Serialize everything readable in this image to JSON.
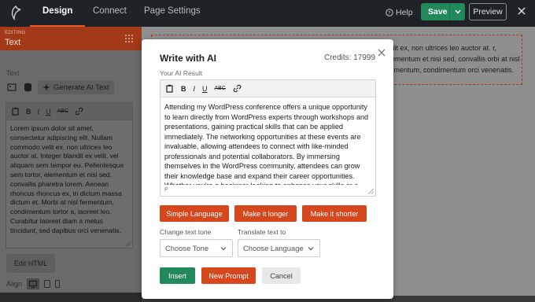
{
  "topbar": {
    "tabs": [
      {
        "label": "Design",
        "active": true
      },
      {
        "label": "Connect",
        "active": false
      },
      {
        "label": "Page Settings",
        "active": false
      }
    ],
    "help_label": "Help",
    "save_label": "Save",
    "preview_label": "Preview",
    "accent_color": "#e8562a"
  },
  "sidebar": {
    "kicker": "EDITING",
    "title": "Text",
    "field_label": "Text",
    "generate_label": "Generate AI Text",
    "editor_text": "Lorem ipsum dolor sit amet, consectetur adipiscing elit. Nullam commodo velit ex, non ultrices leo auctor at. Integer blandit ex velit, vel aliquam sem tempor eu. Pellentesque sem tortor, elementum et nisi sed, convallis pharetra lorem. Aenean rhoncus rhoncus ex, in dictum massa dictum et. Morbi at nisl fermentum, condimentum tortor a, laoreet leo. Curabitur laoreet diam a metus tincidunt, sed dapibus orci venenatis.",
    "edit_html_label": "Edit HTML",
    "align_label": "Align"
  },
  "canvas": {
    "text": "velit ex, non ultrices leo auctor at. r, elementum et nisi sed, convallis orbi at nisl fermentum, condimentum orci venenatis."
  },
  "modal": {
    "title": "Write with AI",
    "credits": "Credits: 17999",
    "result_label": "Your AI Result",
    "result_text": "Attending my WordPress conference offers a unique opportunity to learn directly from WordPress experts through workshops and presentations, gaining practical skills that can be applied immediately. The networking opportunities at these events are invaluable, allowing attendees to connect with like-minded professionals and potential collaborators. By immersing themselves in the WordPress community, attendees can grow their knowledge base and expand their career opportunities. Whether you're a beginner looking to enhance your skills or a seasoned professional seeking to stay current in the industry, a",
    "editor_path": "P",
    "ai_buttons": {
      "simple": "Simple Language",
      "longer": "Make it longer",
      "shorter": "Make it shorter"
    },
    "tone_label": "Change text tone",
    "tone_value": "Choose Tone",
    "translate_label": "Translate text to",
    "translate_value": "Choose Language",
    "insert_label": "Insert",
    "new_prompt_label": "New Prompt",
    "cancel_label": "Cancel",
    "colors": {
      "primary_green": "#21895a",
      "primary_orange": "#d6471d"
    }
  }
}
